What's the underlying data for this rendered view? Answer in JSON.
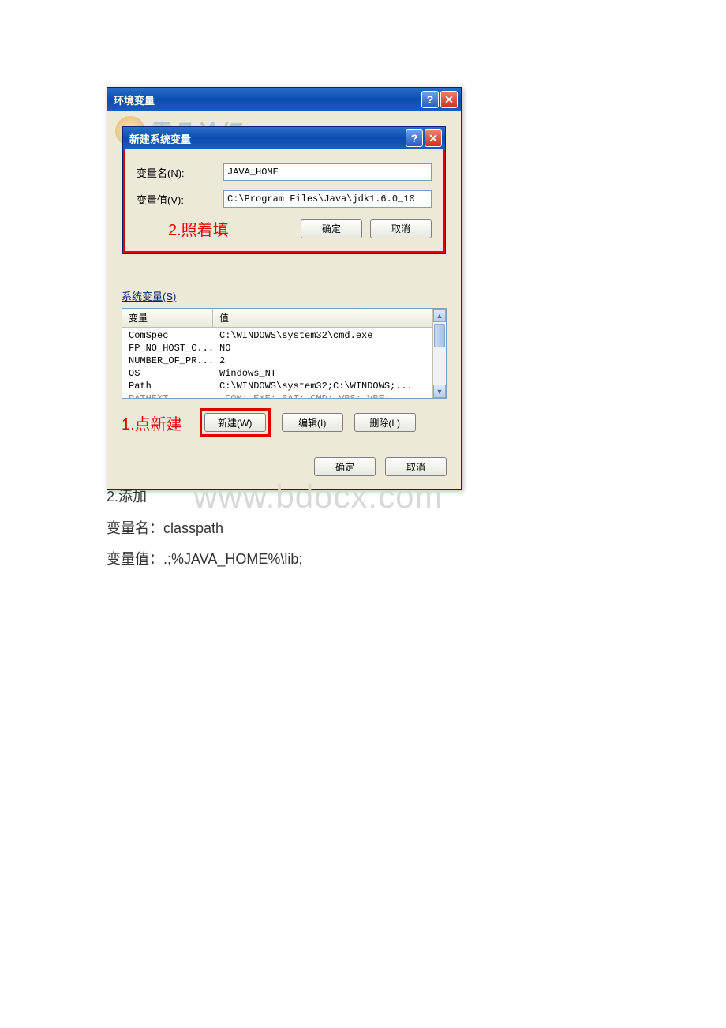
{
  "outer_dialog": {
    "title": "环境变量",
    "help_icon": "?",
    "close_icon": "✕",
    "watermark_text": "霏凡论坛"
  },
  "inner_dialog": {
    "title": "新建系统变量",
    "help_icon": "?",
    "close_icon": "✕",
    "name_label": "变量名(N):",
    "value_label": "变量值(V):",
    "name_value": "JAVA_HOME",
    "value_value": "C:\\Program Files\\Java\\jdk1.6.0_10",
    "annotation": "2.照着填",
    "ok": "确定",
    "cancel": "取消"
  },
  "sys_vars": {
    "group_label": "系统变量(S)",
    "col_name": "变量",
    "col_value": "值",
    "rows": [
      {
        "name": "ComSpec",
        "value": "C:\\WINDOWS\\system32\\cmd.exe"
      },
      {
        "name": "FP_NO_HOST_C...",
        "value": "NO"
      },
      {
        "name": "NUMBER_OF_PR...",
        "value": "2"
      },
      {
        "name": "OS",
        "value": "Windows_NT"
      },
      {
        "name": "Path",
        "value": "C:\\WINDOWS\\system32;C:\\WINDOWS;..."
      },
      {
        "name": "PATHEXT",
        "value": ".COM;.EXE;.BAT;.CMD;.VBS;.VBE;"
      }
    ],
    "annotation": "1.点新建",
    "new_btn": "新建(W)",
    "edit_btn": "编辑(I)",
    "delete_btn": "删除(L)"
  },
  "outer_footer": {
    "ok": "确定",
    "cancel": "取消"
  },
  "below": {
    "line1": "2.添加",
    "line2": "变量名：classpath",
    "line3": "变量值：.;%JAVA_HOME%\\lib;"
  },
  "page_watermark": "www.bdocx.com"
}
